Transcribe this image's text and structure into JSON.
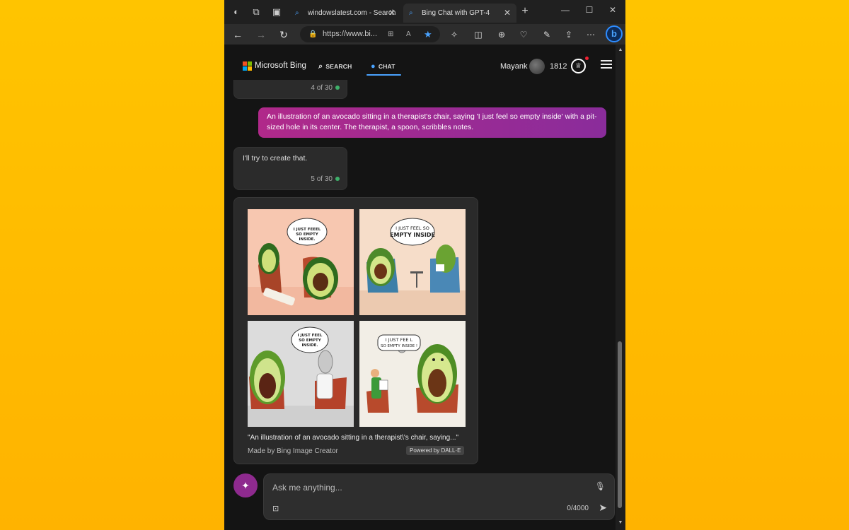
{
  "browser": {
    "tabs": [
      {
        "title": "windowslatest.com - Search",
        "active": false
      },
      {
        "title": "Bing Chat with GPT-4",
        "active": true
      }
    ],
    "new_tab": "+",
    "address": "https://www.bi...",
    "window_controls": {
      "minimize": "—",
      "maximize": "☐",
      "close": "✕"
    }
  },
  "header": {
    "brand": "Microsoft Bing",
    "search_label": "SEARCH",
    "chat_label": "CHAT",
    "user_name": "Mayank",
    "points": "1812"
  },
  "messages": {
    "prev_counter": "4 of 30",
    "user_prompt": "An illustration of an avocado sitting in a therapist's chair, saying 'I just feel so empty inside' with a pit-sized hole in its center. The therapist, a spoon, scribbles notes.",
    "bot_reply": "I'll try to create that.",
    "bot_counter": "5 of 30"
  },
  "image_card": {
    "images": [
      {
        "speech": [
          "I JUST FEEEL",
          "SO EMPTY",
          "INSIDE."
        ]
      },
      {
        "speech": [
          "I JUST FEEL SO",
          "EMPTY INSIDE"
        ]
      },
      {
        "speech": [
          "I JUST FEEL",
          "SO EMPTY",
          "INSIDE."
        ]
      },
      {
        "speech": [
          "I JUST FEE L",
          "SO EMPTY INSIDE !"
        ]
      }
    ],
    "caption": "\"An illustration of an avocado sitting in a therapist\\'s chair, saying...\"",
    "made_by": "Made by Bing Image Creator",
    "powered_by": "Powered by DALL·E"
  },
  "composer": {
    "placeholder": "Ask me anything...",
    "char_count": "0/4000"
  },
  "colors": {
    "user_bubble": "#a3298f",
    "accent": "#4aa3ff",
    "new_topic": "#8e2a8e",
    "background": "#ffc400"
  }
}
